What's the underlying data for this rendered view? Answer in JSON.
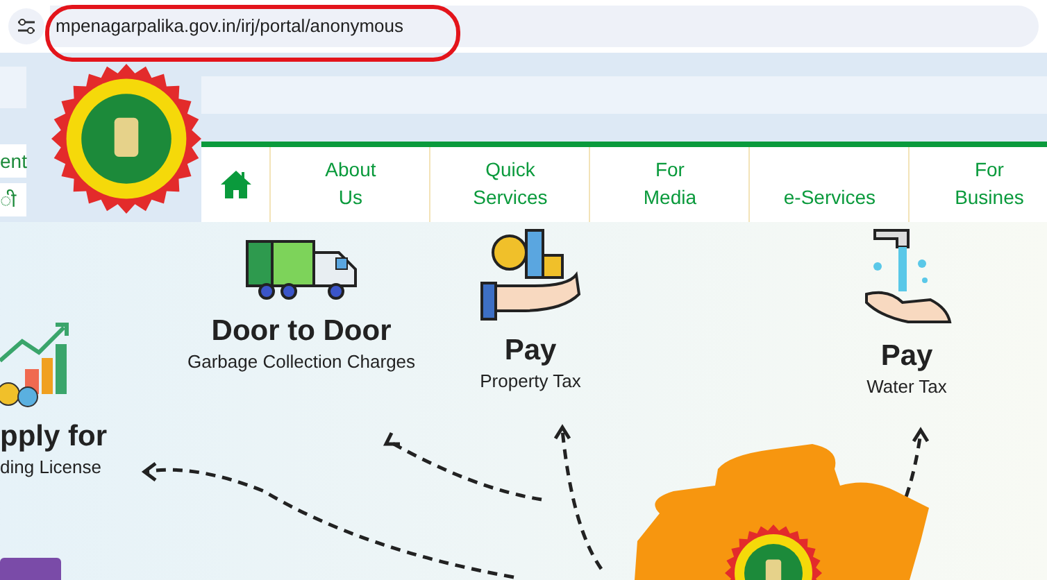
{
  "browser": {
    "url": "mpenagarpalika.gov.in/irj/portal/anonymous"
  },
  "side_menu": [
    "ent",
    "ी"
  ],
  "nav": [
    {
      "kind": "home"
    },
    {
      "kind": "link",
      "lines": [
        "About",
        "Us"
      ]
    },
    {
      "kind": "link",
      "lines": [
        "Quick",
        "Services"
      ]
    },
    {
      "kind": "link",
      "lines": [
        "For",
        "Media"
      ]
    },
    {
      "kind": "link",
      "lines": [
        "e-Services"
      ]
    },
    {
      "kind": "link",
      "lines": [
        "For",
        "Busines"
      ]
    }
  ],
  "services": [
    {
      "kind": "truck",
      "title": "Door to Door",
      "subtitle": "Garbage Collection Charges"
    },
    {
      "kind": "property",
      "title": "Pay",
      "subtitle": "Property Tax"
    },
    {
      "kind": "water",
      "title": "Pay",
      "subtitle": "Water Tax"
    },
    {
      "kind": "chart",
      "title": "pply for",
      "subtitle": "ding License"
    }
  ]
}
